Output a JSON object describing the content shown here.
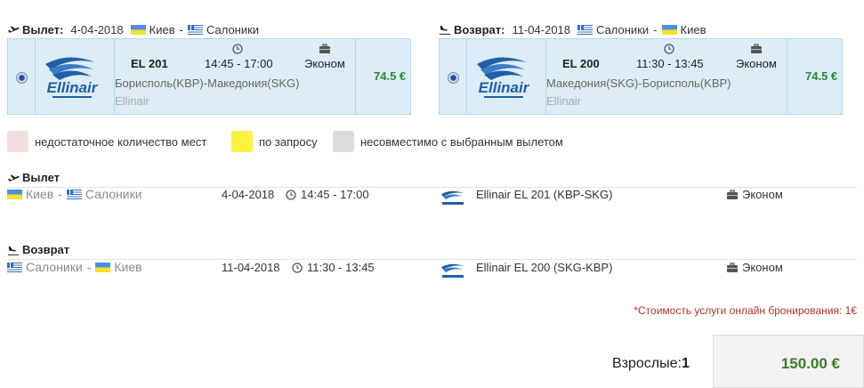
{
  "outbound_header": {
    "title": "Вылет:",
    "date": "4-04-2018",
    "from_city": "Киев",
    "separator": "-",
    "to_city": "Салоники"
  },
  "return_header": {
    "title": "Возврат:",
    "date": "11-04-2018",
    "from_city": "Салоники",
    "separator": "-",
    "to_city": "Киев"
  },
  "outbound_card": {
    "selected": true,
    "airline_logo_text": "Ellinair",
    "flight_code": "EL 201",
    "time": "14:45 - 17:00",
    "class": "Эконом",
    "route": "Борисполь(KBP)-Македония(SKG)",
    "airline": "Ellinair",
    "price": "74.5 €"
  },
  "return_card": {
    "selected": true,
    "airline_logo_text": "Ellinair",
    "flight_code": "EL 200",
    "time": "11:30 - 13:45",
    "class": "Эконом",
    "route": "Македония(SKG)-Борисполь(KBP)",
    "airline": "Ellinair",
    "price": "74.5 €"
  },
  "legend": [
    {
      "label": "недостаточное количество мест",
      "color": "#f3dede"
    },
    {
      "label": "по запросу",
      "color": "#fbf23f"
    },
    {
      "label": "несовместимо с выбранным вылетом",
      "color": "#dcdcdc"
    }
  ],
  "summary": {
    "outbound": {
      "title": "Вылет",
      "from_city": "Киев",
      "separator": "-",
      "to_city": "Салоники",
      "date": "4-04-2018",
      "time": "14:45 - 17:00",
      "flight": "Ellinair EL 201 (KBP-SKG)",
      "class": "Эконом"
    },
    "return": {
      "title": "Возврат",
      "from_city": "Салоники",
      "separator": "-",
      "to_city": "Киев",
      "date": "11-04-2018",
      "time": "11:30 - 13:45",
      "flight": "Ellinair EL 200 (SKG-KBP)",
      "class": "Эконом"
    }
  },
  "service_note": "*Стоимость услуги онлайн бронирования: 1€",
  "passengers": {
    "label": "Взрослые:",
    "count": "1"
  },
  "total": "150.00 €",
  "colors": {
    "card_bg": "#dcedf7",
    "card_border": "#b3d7ec",
    "price_green": "#2a8a2a",
    "total_green": "#3a7a2a",
    "note_red": "#b03030",
    "brand_blue": "#1f5fa8"
  }
}
